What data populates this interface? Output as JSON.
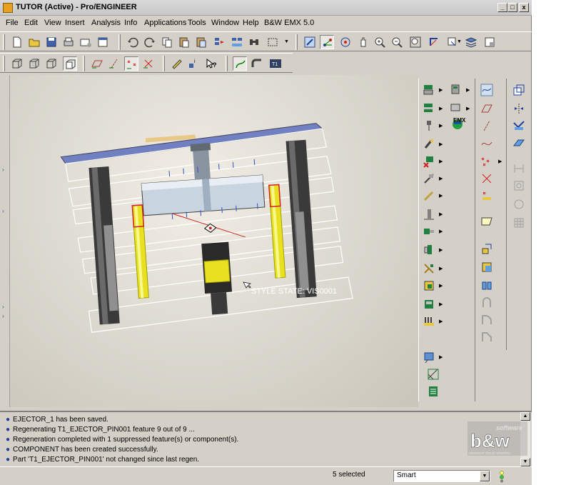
{
  "window": {
    "title": "TUTOR (Active) - Pro/ENGINEER",
    "controls": {
      "minimize": "_",
      "maximize": "□",
      "close": "x"
    }
  },
  "menu": {
    "items": [
      "File",
      "Edit",
      "View",
      "Insert",
      "Analysis",
      "Info",
      "Applications",
      "Tools",
      "Window",
      "Help",
      "B&W EMX 5.0"
    ]
  },
  "viewport": {
    "style_state_label": "STYLE STATE: VIS0001",
    "emx_label": "EMX"
  },
  "messages": [
    "EJECTOR_1 has been saved.",
    "Regenerating T1_EJECTOR_PIN001 feature 9 out of 9 ...",
    "Regeneration completed with 1 suppressed feature(s) or component(s).",
    "COMPONENT has been created successfully.",
    "Part 'T1_EJECTOR_PIN001' not changed since last regen."
  ],
  "logo": {
    "top": "software",
    "main": "b&w",
    "bottom": "advanced mould solutions"
  },
  "status": {
    "selected": "5 selected",
    "filter_value": "Smart",
    "t1_icon": "T1"
  },
  "colors": {
    "accent_yellow": "#e8e020",
    "plate_blue": "#7080c0",
    "viewport_bg": "#dedbd2",
    "ui_bg": "#d4d0c8"
  },
  "icons": {
    "toolbar1": [
      "new-file-icon",
      "open-icon",
      "save-icon",
      "print-icon",
      "email-icon",
      "close-window-icon",
      "undo-icon",
      "redo-icon",
      "copy-icon",
      "paste-icon",
      "paste-special-icon",
      "regenerate-icon",
      "regen-manager-icon",
      "find-icon",
      "select-box-icon",
      "repaint-icon",
      "spin-center-icon",
      "orient-mode-icon",
      "zoom-in-icon",
      "zoom-out-icon",
      "refit-icon",
      "reorient-icon",
      "saved-views-icon",
      "layers-icon",
      "view-manager-icon"
    ],
    "toolbar2": [
      "wireframe-icon",
      "hidden-line-icon",
      "no-hidden-icon",
      "shading-icon",
      "datum-planes-icon",
      "datum-axes-icon",
      "datum-points-icon",
      "coordinate-systems-icon",
      "sketch-tool-icon",
      "info-icon",
      "context-help-icon",
      "curve-icon",
      "pipe-icon",
      "t1-icon"
    ]
  }
}
